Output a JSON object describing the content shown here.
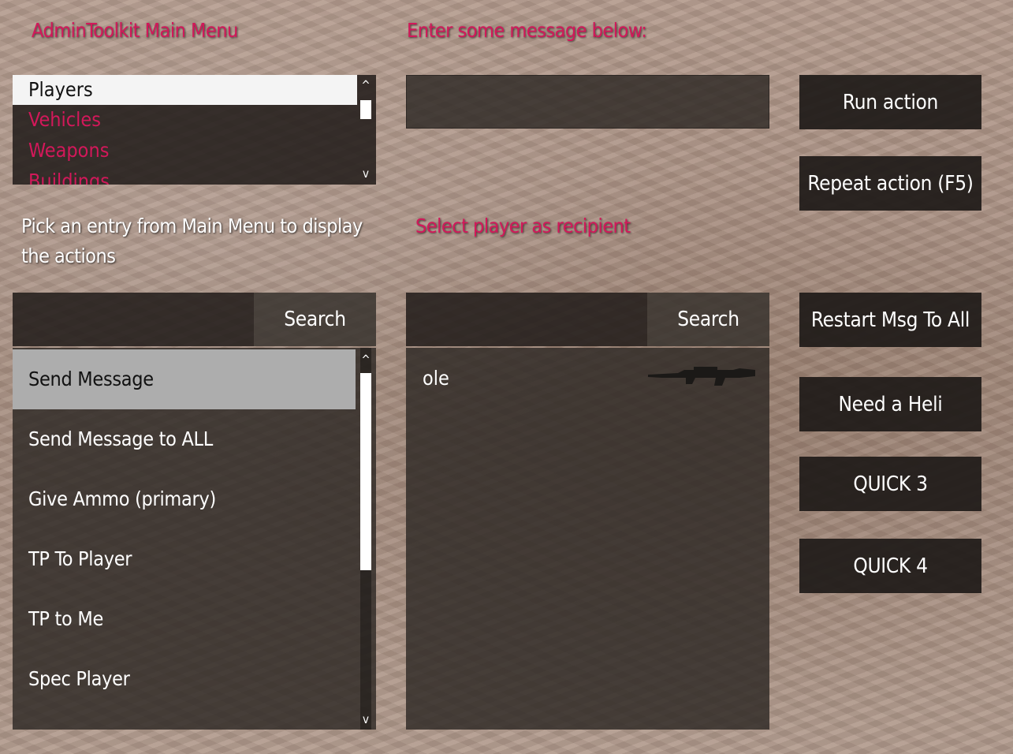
{
  "main_menu": {
    "title": "AdminToolkit Main Menu",
    "items": [
      {
        "label": "Players"
      },
      {
        "label": "Vehicles"
      },
      {
        "label": "Weapons"
      },
      {
        "label": "Buildings"
      }
    ],
    "scroll_up": "^",
    "scroll_down": "v"
  },
  "message": {
    "title": "Enter some message below:",
    "value": ""
  },
  "hint": {
    "text": "Pick an entry from Main Menu to display the actions"
  },
  "recipient": {
    "title": "Select player as recipient"
  },
  "action_search": {
    "value": "",
    "button_label": "Search"
  },
  "player_search": {
    "value": "",
    "button_label": "Search"
  },
  "actions": {
    "items": [
      {
        "label": "Send Message"
      },
      {
        "label": "Send Message to ALL"
      },
      {
        "label": "Give Ammo (primary)"
      },
      {
        "label": "TP To Player"
      },
      {
        "label": "TP to Me"
      },
      {
        "label": "Spec Player"
      }
    ],
    "scroll_up": "^",
    "scroll_down": "v"
  },
  "players": {
    "items": [
      {
        "name": "ole",
        "weapon_icon": "rifle-icon"
      }
    ]
  },
  "buttons": {
    "run_action": "Run action",
    "repeat_action": "Repeat action (F5)",
    "restart_msg": "Restart Msg To All",
    "need_heli": "Need a Heli",
    "quick3": "QUICK 3",
    "quick4": "QUICK 4"
  },
  "colors": {
    "accent": "#d2185a",
    "panel": "#231e1b",
    "selected_light": "#f4f4f4",
    "selected_gray": "#adadad"
  }
}
